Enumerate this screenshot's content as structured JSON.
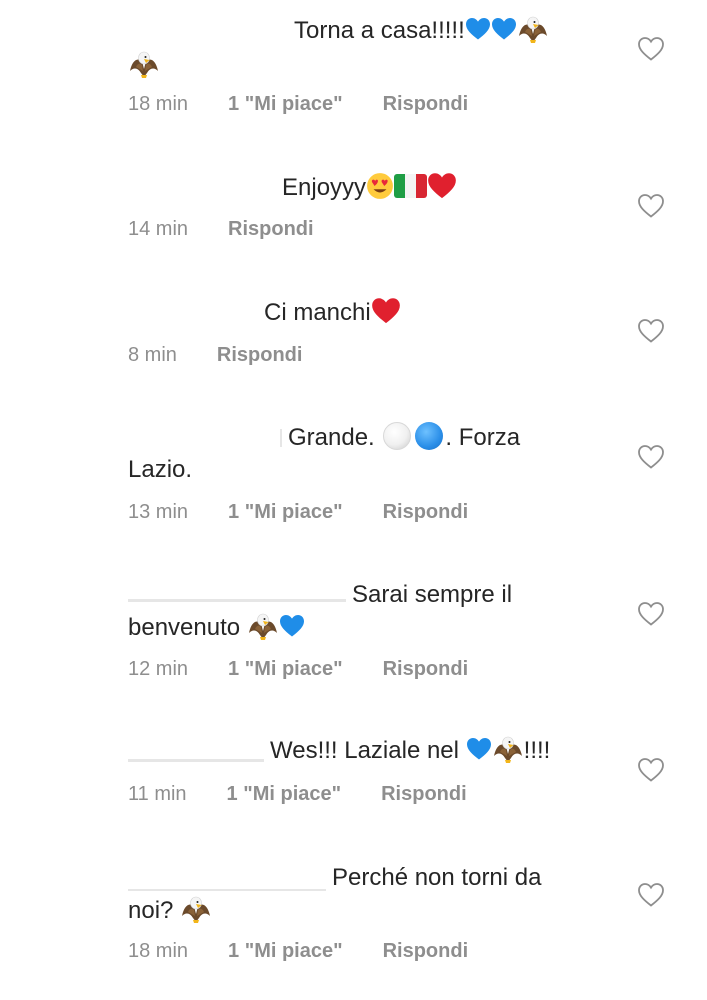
{
  "comments": [
    {
      "line1": "Torna a casa!!!!!",
      "line2": "",
      "time": "18 min",
      "likes": "1 \"Mi piace\"",
      "reply": "Rispondi"
    },
    {
      "line1": "Enjoyyy",
      "time": "14 min",
      "reply": "Rispondi"
    },
    {
      "line1": "Ci manchi",
      "time": "8 min",
      "reply": "Rispondi"
    },
    {
      "line1": "Grande. ",
      "line1b": ". Forza",
      "line2": "Lazio.",
      "time": "13 min",
      "likes": "1 \"Mi piace\"",
      "reply": "Rispondi"
    },
    {
      "line1": "Sarai sempre il",
      "line2": "benvenuto ",
      "time": "12 min",
      "likes": "1 \"Mi piace\"",
      "reply": "Rispondi"
    },
    {
      "line1": "Wes!!! Laziale nel ",
      "line1b": "!!!!",
      "time": "11 min",
      "likes": "1 \"Mi piace\"",
      "reply": "Rispondi"
    },
    {
      "line1": "Perché non torni da",
      "line2": "noi? ",
      "time": "18 min",
      "likes": "1 \"Mi piace\"",
      "reply": "Rispondi"
    }
  ],
  "icons": {
    "like": "heart-outline-icon",
    "blue_heart": "blue-heart-emoji",
    "red_heart": "red-heart-emoji",
    "eagle": "eagle-emoji",
    "heart_eyes": "heart-eyes-emoji",
    "italy_flag": "italy-flag-emoji",
    "white_circle": "white-circle-emoji",
    "blue_circle": "blue-circle-emoji"
  },
  "colors": {
    "text": "#262626",
    "meta": "#8e8e8e",
    "blue_heart": "#1f8de8",
    "red_heart": "#e0202e"
  }
}
